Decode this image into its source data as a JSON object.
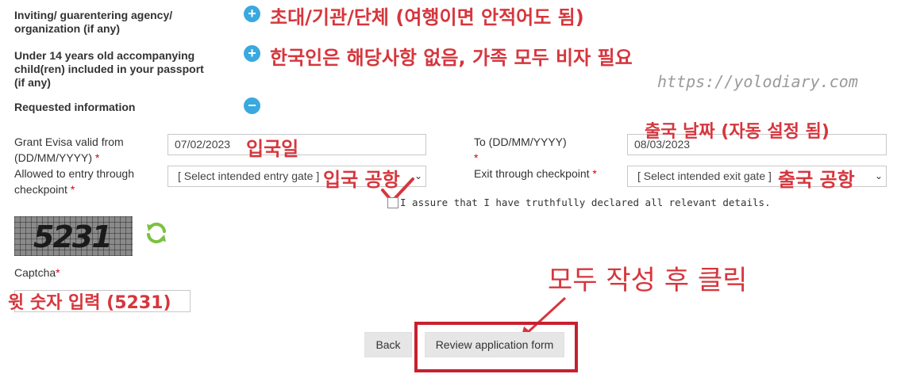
{
  "form": {
    "inviting_label": "Inviting/ guarentering agency/ organization (if any)",
    "children_label": "Under 14 years old accompanying child(ren) included in your passport (if any)",
    "requested_label": "Requested information",
    "grant_from_label": "Grant Evisa valid from (DD/MM/YYYY)",
    "grant_from_value": "07/02/2023",
    "to_label": "To (DD/MM/YYYY)",
    "to_value": "08/03/2023",
    "entry_label": "Allowed to entry through checkpoint",
    "entry_placeholder": "[ Select intended entry gate ]",
    "exit_label": "Exit through checkpoint",
    "exit_placeholder": "[ Select intended exit gate ]",
    "assure_label": "I assure that I have truthfully declared all relevant details.",
    "captcha_image_text": "5231",
    "captcha_label": "Captcha",
    "required_mark": "*",
    "plus_sign": "+",
    "minus_sign": "−",
    "caret": "⌄"
  },
  "buttons": {
    "back": "Back",
    "review": "Review application form"
  },
  "annotations": {
    "inviting": "초대/기관/단체 (여행이면 안적어도 됨)",
    "children": "한국인은 해당사항 없음, 가족 모두 비자 필요",
    "watermark": "https://yolodiary.com",
    "entry_date": "입국일",
    "exit_date": "출국 날짜 (자동 설정 됨)",
    "entry_gate": "입국 공항",
    "exit_gate": "출국 공항",
    "captcha": "윗 숫자 입력 (5231)",
    "click": "모두 작성 후 클릭"
  },
  "colors": {
    "annotation": "#d6363d",
    "toggle": "#39a9de",
    "refresh": "#7cc142"
  }
}
